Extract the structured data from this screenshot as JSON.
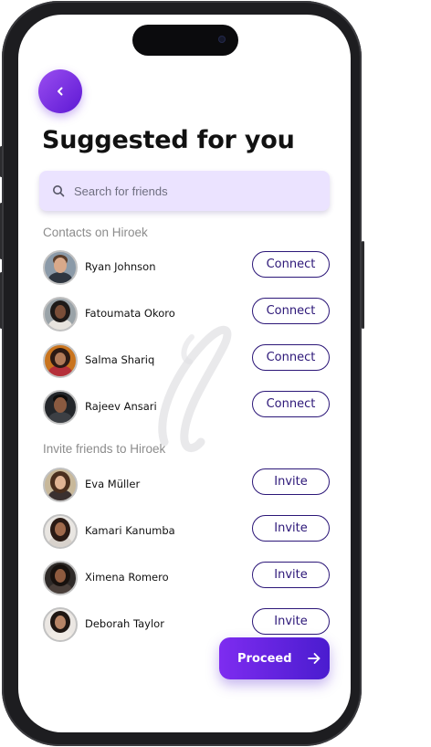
{
  "header": {
    "title": "Suggested for you"
  },
  "search": {
    "placeholder": "Search for friends"
  },
  "contacts": {
    "label": "Contacts on Hiroek",
    "items": [
      {
        "name": "Ryan Johnson",
        "action": "Connect"
      },
      {
        "name": "Fatoumata Okoro",
        "action": "Connect"
      },
      {
        "name": "Salma Shariq",
        "action": "Connect"
      },
      {
        "name": "Rajeev Ansari",
        "action": "Connect"
      }
    ]
  },
  "invite": {
    "label": "Invite friends to Hiroek",
    "items": [
      {
        "name": "Eva Müller",
        "action": "Invite"
      },
      {
        "name": "Kamari Kanumba",
        "action": "Invite"
      },
      {
        "name": "Ximena Romero",
        "action": "Invite"
      },
      {
        "name": "Deborah Taylor",
        "action": "Invite"
      }
    ]
  },
  "footer": {
    "proceed_label": "Proceed"
  },
  "icons": {
    "back": "chevron-left-icon",
    "search": "search-icon",
    "proceed": "arrow-right-icon"
  },
  "colors": {
    "accent": "#6a28e0",
    "accent_dark": "#2c1778",
    "search_bg": "#ebe3ff"
  }
}
